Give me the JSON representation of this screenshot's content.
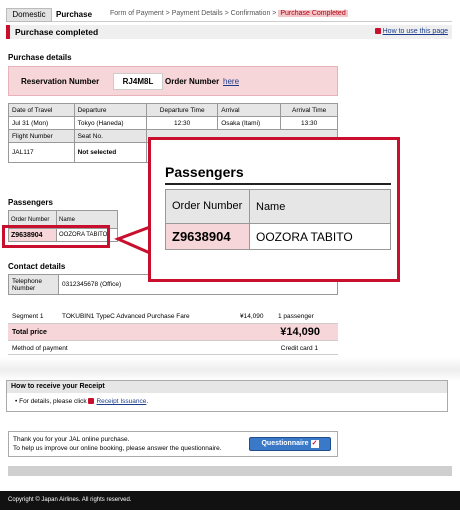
{
  "nav": {
    "tab_domestic": "Domestic",
    "tab_purchase": "Purchase",
    "steps": [
      "Form of Payment",
      "Payment Details",
      "Confirmation"
    ],
    "active_step": "Purchase Completed",
    "separator": ">"
  },
  "title": {
    "text": "Purchase completed",
    "help_link": "How to use this page"
  },
  "purchase_details": {
    "heading": "Purchase details",
    "reservation_label": "Reservation Number",
    "reservation_number": "RJ4M8L",
    "order_label": "Order Number",
    "order_link": "here"
  },
  "flight": {
    "headers": [
      "Date of Travel",
      "Departure",
      "Departure Time",
      "Arrival",
      "Arrival Time"
    ],
    "row": [
      "Jul 31 (Mon)",
      "Tokyo (Haneda)",
      "12:30",
      "Osaka (Itami)",
      "13:30"
    ],
    "headers2": [
      "Flight Number",
      "Seat No."
    ],
    "row2": [
      "JAL117",
      "Not selected"
    ]
  },
  "passengers": {
    "heading": "Passengers",
    "col_order": "Order Number",
    "col_name": "Name",
    "order_number": "Z9638904",
    "name": "OOZORA TABITO",
    "name_truncated": "OOZORA TABITO"
  },
  "contact": {
    "heading": "Contact details",
    "label": "Telephone Number",
    "value": "0312345678 (Office)"
  },
  "fare": {
    "segment": "Segment 1",
    "fare_name": "TOKUBIN1 TypeC Advanced Purchase Fare",
    "fare_amount": "¥14,090",
    "passengers": "1 passenger",
    "total_label": "Total price",
    "total_amount": "¥14,090",
    "method_label": "Method of payment",
    "method_value": "Credit card 1"
  },
  "receipt": {
    "heading": "How to receive your Receipt",
    "text": "For details, please click",
    "link": "Receipt Issuance",
    "tail": "."
  },
  "thanks": {
    "line1": "Thank you for your JAL online purchase.",
    "line2": "To help us improve our online booking, please answer the questionnaire.",
    "button": "Questionnaire"
  },
  "footer": {
    "copyright": "Copyright © Japan Airlines. All rights reserved."
  },
  "colors": {
    "accent_red": "#c8102e",
    "highlight_pink": "#f7d6d9",
    "link_blue": "#1a3c8a",
    "button_blue": "#3a79c8"
  }
}
